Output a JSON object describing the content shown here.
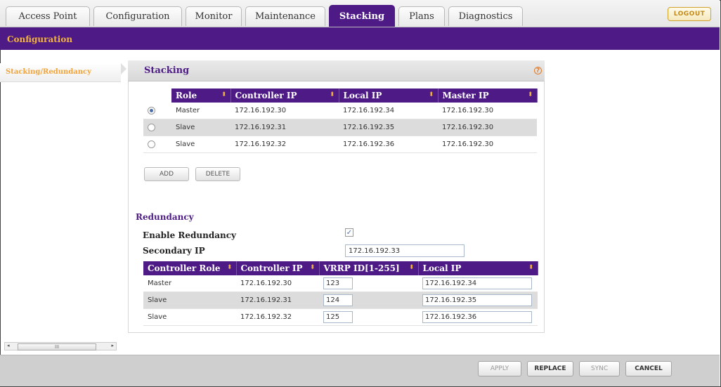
{
  "tabs": [
    {
      "label": "Access Point",
      "active": false
    },
    {
      "label": "Configuration",
      "active": false
    },
    {
      "label": "Monitor",
      "active": false
    },
    {
      "label": "Maintenance",
      "active": false
    },
    {
      "label": "Stacking",
      "active": true
    },
    {
      "label": "Plans",
      "active": false
    },
    {
      "label": "Diagnostics",
      "active": false
    }
  ],
  "logout_label": "LOGOUT",
  "subbar_title": "Configuration",
  "sidebar": {
    "items": [
      {
        "label": "Stacking/Redundancy",
        "selected": true
      }
    ]
  },
  "stacking": {
    "title": "Stacking",
    "help_icon": "?",
    "columns": [
      "Role",
      "Controller IP",
      "Local IP",
      "Master IP"
    ],
    "rows": [
      {
        "selected": true,
        "role": "Master",
        "controller_ip": "172.16.192.30",
        "local_ip": "172.16.192.34",
        "master_ip": "172.16.192.30"
      },
      {
        "selected": false,
        "role": "Slave",
        "controller_ip": "172.16.192.31",
        "local_ip": "172.16.192.35",
        "master_ip": "172.16.192.30"
      },
      {
        "selected": false,
        "role": "Slave",
        "controller_ip": "172.16.192.32",
        "local_ip": "172.16.192.36",
        "master_ip": "172.16.192.30"
      }
    ],
    "add_label": "ADD",
    "delete_label": "DELETE"
  },
  "redundancy": {
    "title": "Redundancy",
    "enable_label": "Enable Redundancy",
    "enabled": true,
    "check_mark": "✓",
    "secondary_ip_label": "Secondary IP",
    "secondary_ip_value": "172.16.192.33",
    "columns": [
      "Controller Role",
      "Controller IP",
      "VRRP ID[1-255]",
      "Local IP"
    ],
    "rows": [
      {
        "role": "Master",
        "controller_ip": "172.16.192.30",
        "vrrp_id": "123",
        "local_ip": "172.16.192.34"
      },
      {
        "role": "Slave",
        "controller_ip": "172.16.192.31",
        "vrrp_id": "124",
        "local_ip": "172.16.192.35"
      },
      {
        "role": "Slave",
        "controller_ip": "172.16.192.32",
        "vrrp_id": "125",
        "local_ip": "172.16.192.36"
      }
    ]
  },
  "scrollbar": {
    "thumb_label": "III",
    "left_arrow": "◂",
    "right_arrow": "▸"
  },
  "footer": {
    "apply_label": "APPLY",
    "replace_label": "REPLACE",
    "sync_label": "SYNC",
    "cancel_label": "CANCEL"
  },
  "colors": {
    "brand_purple": "#4e1b86",
    "accent_orange": "#f2b33d",
    "sidebar_orange": "#f2a43a"
  }
}
